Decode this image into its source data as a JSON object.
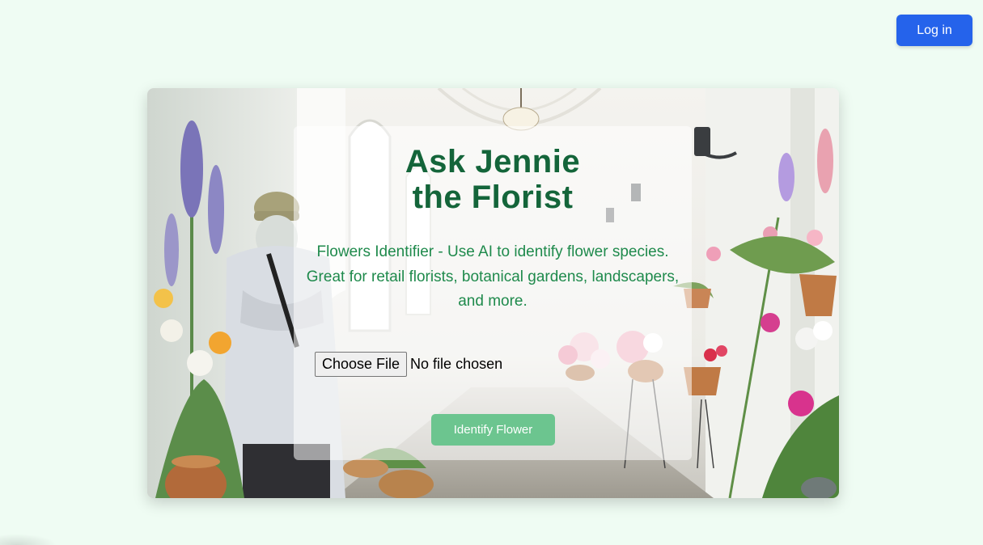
{
  "header": {
    "login_label": "Log in"
  },
  "hero": {
    "title_line1": "Ask Jennie",
    "title_line2": "the Florist",
    "description": "Flowers Identifier - Use AI to identify flower species. Great for retail florists, botanical gardens, landscapers, and more.",
    "file_button_label": "Choose File",
    "file_status": "No file chosen",
    "identify_label": "Identify Flower"
  },
  "colors": {
    "background": "#effcf3",
    "login_button": "#2563eb",
    "title": "#14653a",
    "description": "#1f8a4c",
    "identify_button": "#6cc58f"
  }
}
